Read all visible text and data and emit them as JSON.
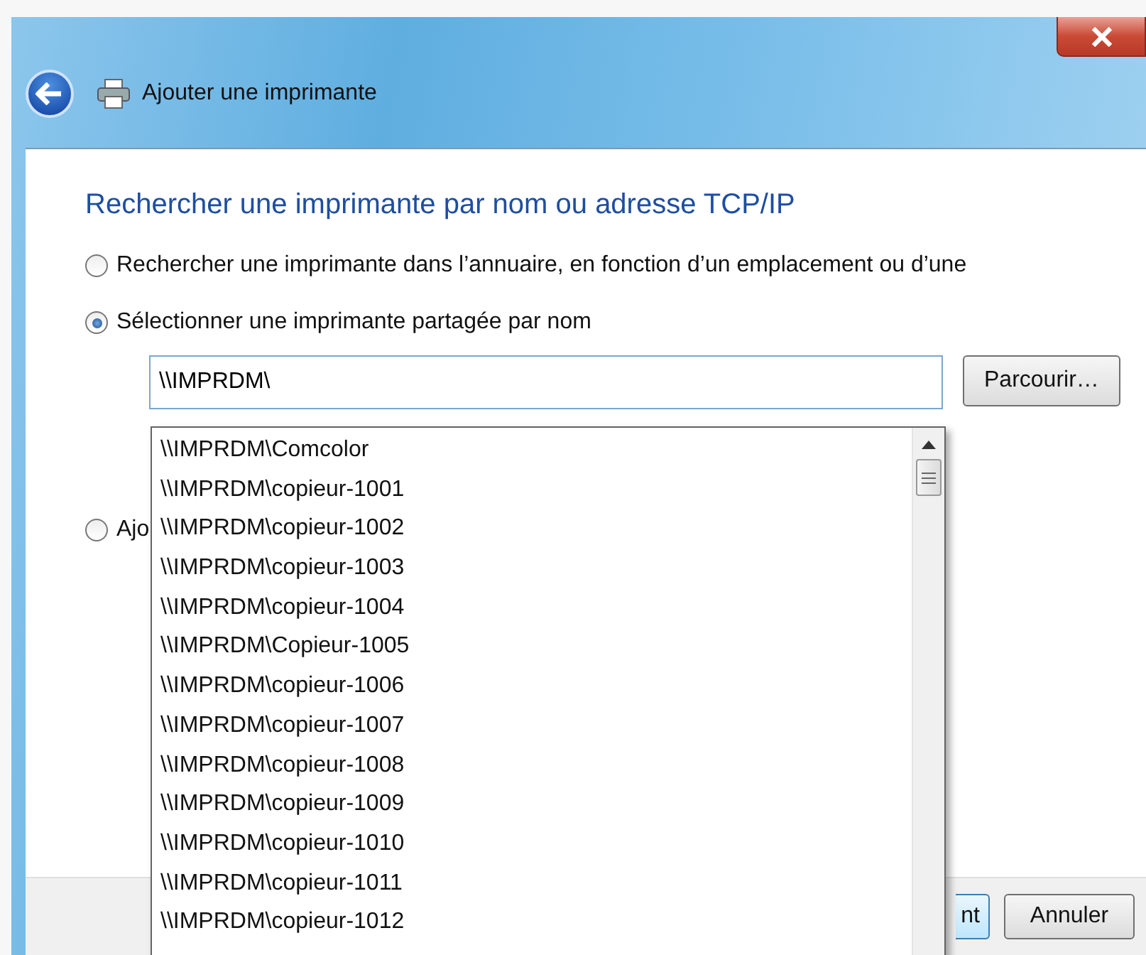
{
  "window": {
    "title": "Ajouter une imprimante"
  },
  "heading": "Rechercher une imprimante par nom ou adresse TCP/IP",
  "options": [
    {
      "label": "Rechercher une imprimante dans l’annuaire, en fonction d’un emplacement ou d’une",
      "selected": false
    },
    {
      "label": "Sélectionner une imprimante partagée par nom",
      "selected": true
    },
    {
      "label": "Ajo",
      "selected": false
    }
  ],
  "share_path": {
    "value": "\\\\IMPRDM\\"
  },
  "browse_button": "Parcourir…",
  "suggestions": [
    "\\\\IMPRDM\\Comcolor",
    "\\\\IMPRDM\\copieur-1001",
    "\\\\IMPRDM\\copieur-1002",
    "\\\\IMPRDM\\copieur-1003",
    "\\\\IMPRDM\\copieur-1004",
    "\\\\IMPRDM\\Copieur-1005",
    "\\\\IMPRDM\\copieur-1006",
    "\\\\IMPRDM\\copieur-1007",
    "\\\\IMPRDM\\copieur-1008",
    "\\\\IMPRDM\\copieur-1009",
    "\\\\IMPRDM\\copieur-1010",
    "\\\\IMPRDM\\copieur-1011",
    "\\\\IMPRDM\\copieur-1012"
  ],
  "footer_buttons": [
    "nt",
    "Annuler"
  ]
}
